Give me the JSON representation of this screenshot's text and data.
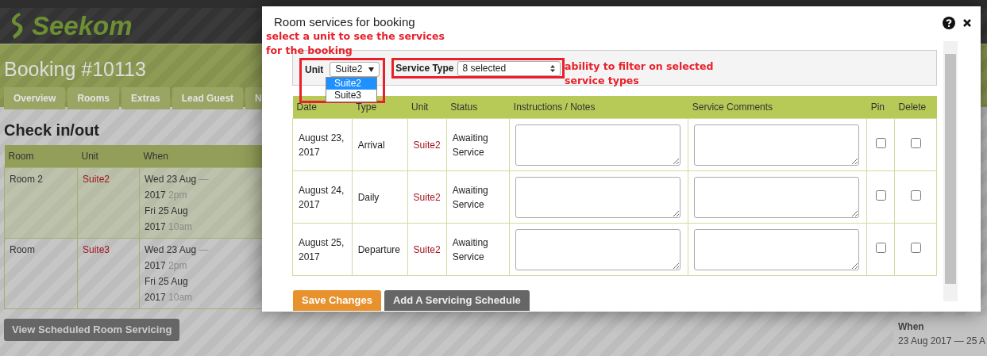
{
  "background_page": {
    "logo": "Seekom",
    "heading": "Booking #10113",
    "tabs": [
      {
        "label": "Overview"
      },
      {
        "label": "Rooms"
      },
      {
        "label": "Extras"
      },
      {
        "label": "Lead Guest"
      },
      {
        "label": "N"
      }
    ],
    "section_title": "Check in/out",
    "checkin_table": {
      "columns": [
        "Room",
        "Unit",
        "When"
      ],
      "rows": [
        {
          "room": "Room 2",
          "unit": "Suite2",
          "start_date": "Wed 23 Aug",
          "separator": "—",
          "start_year": "2017",
          "start_time": "2pm",
          "end_date": "Fri 25 Aug",
          "end_year": "2017",
          "end_time": "10am",
          "highlighted": true
        },
        {
          "room": "Room",
          "unit": "Suite3",
          "start_date": "Wed 23 Aug",
          "separator": "—",
          "start_year": "2017",
          "start_time": "2pm",
          "end_date": "Fri 25 Aug",
          "end_year": "2017",
          "end_time": "10am",
          "highlighted": false
        }
      ]
    },
    "button": "View Scheduled Room Servicing",
    "side_panel": {
      "label": "When",
      "value": "23 Aug 2017 — 25 A"
    }
  },
  "modal": {
    "title": "Room services for booking",
    "annotations": [
      {
        "text": "select a unit to see the services for the booking"
      },
      {
        "text": "ability to filter on selected service types"
      }
    ],
    "filters": {
      "unit": {
        "label": "Unit",
        "value": "Suite2",
        "options": [
          {
            "label": "Suite2",
            "selected": true
          },
          {
            "label": "Suite3",
            "selected": false
          }
        ]
      },
      "service_type": {
        "label": "Service Type",
        "value": "8 selected"
      }
    },
    "table": {
      "columns": [
        "Date",
        "Type",
        "Unit",
        "Status",
        "Instructions / Notes",
        "Service Comments",
        "Pin",
        "Delete"
      ],
      "rows": [
        {
          "date": "August 23, 2017",
          "type": "Arrival",
          "unit": "Suite2",
          "status": "Awaiting Service",
          "pin": false,
          "delete": false
        },
        {
          "date": "August 24, 2017",
          "type": "Daily",
          "unit": "Suite2",
          "status": "Awaiting Service",
          "pin": false,
          "delete": false
        },
        {
          "date": "August 25, 2017",
          "type": "Departure",
          "unit": "Suite2",
          "status": "Awaiting Service",
          "pin": false,
          "delete": false
        }
      ]
    },
    "buttons": [
      {
        "label": "Save Changes",
        "kind": "primary"
      },
      {
        "label": "Add A Servicing Schedule",
        "kind": "secondary"
      }
    ]
  }
}
